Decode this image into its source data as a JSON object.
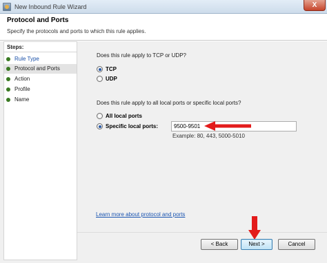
{
  "window": {
    "title": "New Inbound Rule Wizard",
    "close_glyph": "X"
  },
  "header": {
    "title": "Protocol and Ports",
    "subtitle": "Specify the protocols and ports to which this rule applies."
  },
  "steps": {
    "title": "Steps:",
    "items": [
      {
        "label": "Rule Type"
      },
      {
        "label": "Protocol and Ports"
      },
      {
        "label": "Action"
      },
      {
        "label": "Profile"
      },
      {
        "label": "Name"
      }
    ],
    "active_index": 1,
    "dot_color": "#3a7a23"
  },
  "protocol": {
    "question": "Does this rule apply to TCP or UDP?",
    "options": [
      {
        "label": "TCP",
        "selected": true
      },
      {
        "label": "UDP",
        "selected": false
      }
    ]
  },
  "ports": {
    "question": "Does this rule apply to all local ports or specific local ports?",
    "options": [
      {
        "label": "All local ports",
        "selected": false
      },
      {
        "label": "Specific local ports:",
        "selected": true
      }
    ],
    "value": "9500-9501",
    "example": "Example: 80, 443, 5000-5010"
  },
  "learn_more": "Learn more about protocol and ports",
  "buttons": {
    "back": "< Back",
    "next": "Next >",
    "cancel": "Cancel"
  },
  "annotation_color": "#e31b1b",
  "link_color": "#1b55b1"
}
